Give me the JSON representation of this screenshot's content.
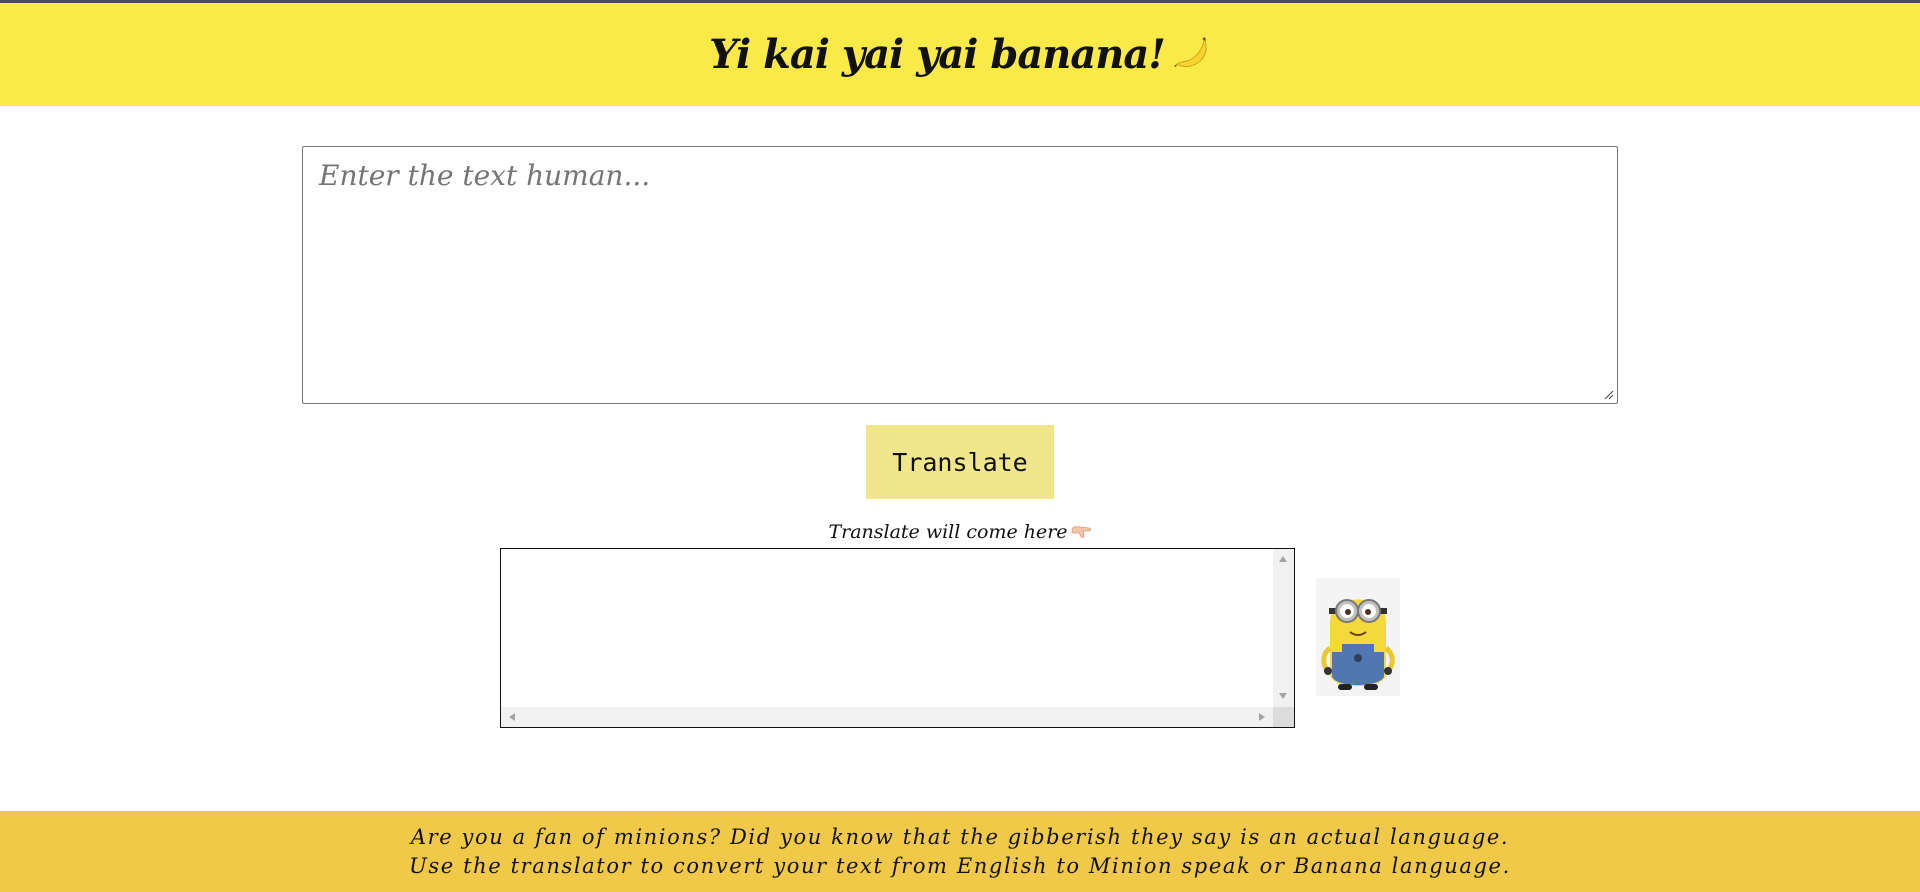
{
  "header": {
    "title": "Yi kai yai yai banana!",
    "title_emoji_icon": "banana-icon",
    "background_color": "#f9ea47"
  },
  "input": {
    "placeholder": "Enter the text human..."
  },
  "translate_button": {
    "label": "Translate",
    "background_color": "#f0e68c"
  },
  "output": {
    "label": "Translate will come here",
    "label_icon": "pointing-down-hand-icon",
    "value": ""
  },
  "mascot": {
    "icon": "minion-image"
  },
  "footer": {
    "line1": "Are you a fan of minions? Did you know that the gibberish they say is an actual language.",
    "line2": "Use the translator to convert your text from English to Minion speak or Banana language.",
    "background_color": "#f0c948"
  }
}
